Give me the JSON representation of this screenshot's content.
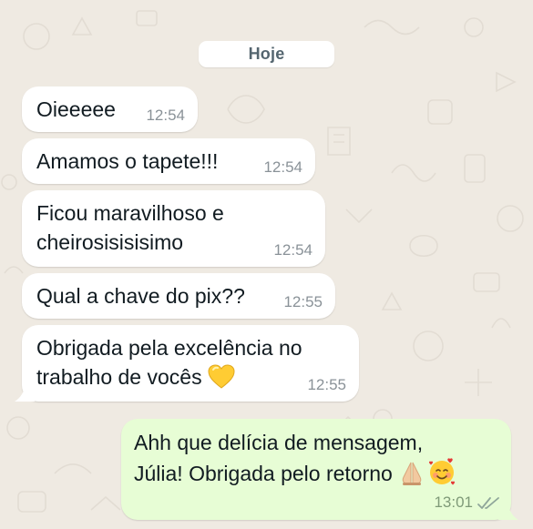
{
  "date_separator": "Hoje",
  "messages": [
    {
      "text": "Oieeeee",
      "time": "12:54"
    },
    {
      "text": "Amamos o tapete!!!",
      "time": "12:54"
    },
    {
      "line1": "Ficou maravilhoso e",
      "line2": "cheirosisisisimo",
      "time": "12:54"
    },
    {
      "text": "Qual a chave do pix??",
      "time": "12:55"
    },
    {
      "line1": "Obrigada pela excelência no",
      "line2": "trabalho de vocês",
      "time": "12:55",
      "emoji": "yellow-heart"
    }
  ],
  "reply": {
    "line1": "Ahh que delícia de mensagem,",
    "line2": "Júlia! Obrigada pelo retorno",
    "time": "13:01",
    "emojis": [
      "folded-hands",
      "smiling-face-with-hearts"
    ],
    "status": "read"
  },
  "colors": {
    "background": "#efeae2",
    "incoming_bubble": "#ffffff",
    "outgoing_bubble": "#e7fdd5",
    "timestamp": "#8a9298",
    "heart": "#ffcc33"
  }
}
